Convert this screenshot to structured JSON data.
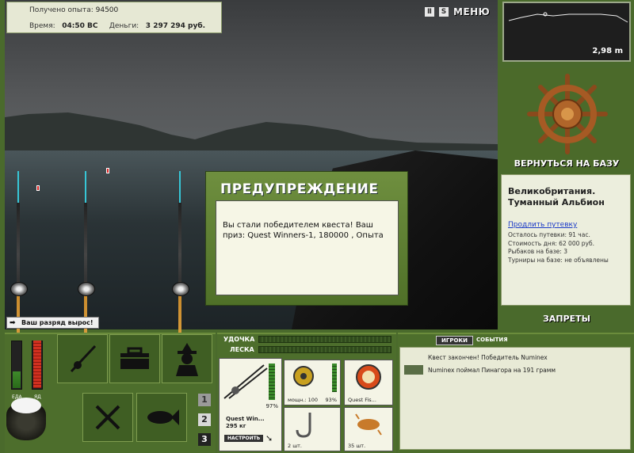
{
  "stats": {
    "exp_label": "Получено опыта:",
    "exp_value": "94500",
    "time_label": "Время:",
    "time_value": "04:50 ВС",
    "money_label": "Деньги:",
    "money_value": "3 297 294 руб."
  },
  "top_bar": {
    "pause_icon": "pause-icon",
    "settings_letter": "S",
    "menu_label": "МЕНЮ"
  },
  "depth": {
    "value": "2,98 m"
  },
  "rank": {
    "message": "Ваш разряд вырос!"
  },
  "dialog": {
    "title": "ПРЕДУПРЕЖДЕНИЕ",
    "text": "Вы стали победителем квеста! Ваш приз: Quest Winners-1, 180000 , Опыта"
  },
  "base": {
    "return_label": "ВЕРНУТЬСЯ НА БАЗУ",
    "name": "Великобритания. Туманный Альбион",
    "extend_link": "Продлить путевку",
    "lines": [
      "Осталось путевки: 91 час.",
      "Стоимость дня: 62 000 руб.",
      "Рыбаков на базе: 3",
      "Турниры на базе: не объявлены"
    ],
    "bans_label": "ЗАПРЕТЫ"
  },
  "status_bars": {
    "food_label": "ЕДА",
    "poison_label": "ЯД",
    "food_level": 0.35,
    "poison_level": 1.0
  },
  "action_tiles": [
    "rod-tile-icon",
    "tackle-box-icon",
    "fisherman-icon",
    "cutlery-icon",
    "fish-tile-icon"
  ],
  "slots": [
    "1",
    "2",
    "3"
  ],
  "gear": {
    "rod_label": "УДОЧКА",
    "line_label": "ЛЕСКА",
    "rod_name": "Quest Win...",
    "rod_weight": "295 кг",
    "rod_pct": "97%",
    "setup_label": "НАСТРОИТЬ",
    "reel_caption": "мощн.: 100",
    "reel_pct": "93%",
    "line_caption": "Quest Fis...",
    "hook_caption": "2 шт.",
    "bait_caption": "35 шт."
  },
  "chat": {
    "tab_players": "ИГРОКИ",
    "tab_events": "СОБЫТИЯ",
    "messages": [
      "Квест закончен! Победитель Numinex",
      "Numinex поймал Пинагора на 191 грамм"
    ]
  },
  "colors": {
    "frame": "#4d6e2c",
    "panel": "#eceedd",
    "accent_link": "#1a3ac8"
  }
}
